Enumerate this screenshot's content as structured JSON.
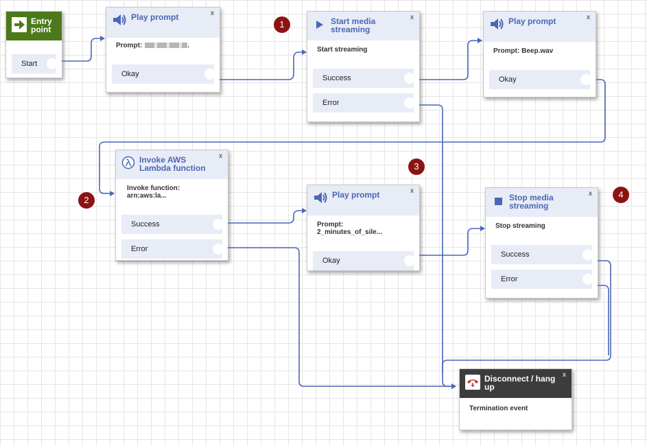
{
  "entry": {
    "title": "Entry point",
    "exit": "Start"
  },
  "prompt1": {
    "title": "Play prompt",
    "body": "Prompt:",
    "body_suffix": ".",
    "exit": "Okay"
  },
  "start_media": {
    "title": "Start media streaming",
    "body": "Start streaming",
    "exits": [
      "Success",
      "Error"
    ]
  },
  "prompt2": {
    "title": "Play prompt",
    "body": "Prompt: Beep.wav",
    "exit": "Okay"
  },
  "lambda": {
    "title": "Invoke AWS Lambda function",
    "body": "Invoke function: arn:aws:la...",
    "exits": [
      "Success",
      "Error"
    ]
  },
  "prompt3": {
    "title": "Play prompt",
    "body": "Prompt: 2_minutes_of_sile...",
    "exit": "Okay"
  },
  "stop_media": {
    "title": "Stop media streaming",
    "body": "Stop streaming",
    "exits": [
      "Success",
      "Error"
    ]
  },
  "disconnect": {
    "title": "Disconnect / hang up",
    "body": "Termination event"
  },
  "close_label": "x",
  "markers": [
    "1",
    "2",
    "3",
    "4"
  ],
  "colors": {
    "accent": "#4a67b5",
    "marker": "#8b1412",
    "entry_header": "#4c7a1a",
    "disconnect_header": "#3c3c3c"
  }
}
